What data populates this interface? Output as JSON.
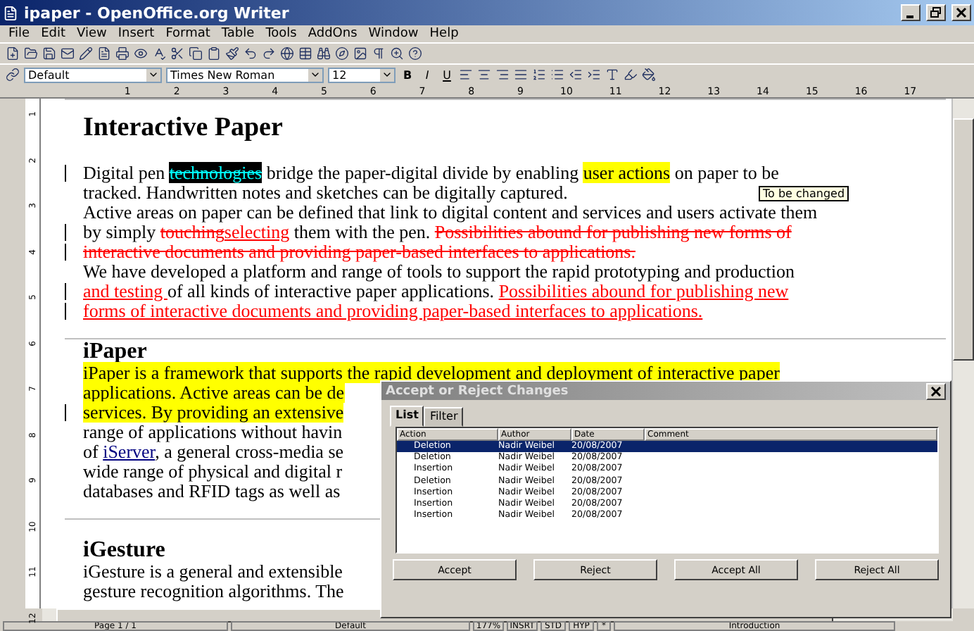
{
  "window": {
    "title": "ipaper - OpenOffice.org Writer"
  },
  "menu": [
    "File",
    "Edit",
    "View",
    "Insert",
    "Format",
    "Table",
    "Tools",
    "AddOns",
    "Window",
    "Help"
  ],
  "format_bar": {
    "style": "Default",
    "font": "Times New Roman",
    "size": "12",
    "bold": "B",
    "italic": "I",
    "underline": "U"
  },
  "ruler": {
    "horizontal": [
      "1",
      "2",
      "3",
      "4",
      "5",
      "6",
      "7",
      "8",
      "9",
      "10",
      "11",
      "12",
      "13",
      "14",
      "15",
      "16",
      "17"
    ],
    "vertical": [
      "1",
      "2",
      "3",
      "4",
      "5",
      "6",
      "7",
      "8",
      "9",
      "10",
      "11",
      "12"
    ]
  },
  "document": {
    "sections": [
      {
        "heading": "Interactive Paper",
        "kind": "title",
        "paragraphs": [
          [
            {
              "changed": true,
              "segments": [
                {
                  "kind": "normal",
                  "text": "Digital pen "
                },
                {
                  "kind": "selected_deletion",
                  "text": "technologies"
                },
                {
                  "kind": "normal",
                  "text": " bridge the paper-digital divide by enabling "
                },
                {
                  "kind": "highlight",
                  "text": "user actions"
                },
                {
                  "kind": "normal",
                  "text": " on paper to be"
                }
              ]
            },
            {
              "changed": false,
              "segments": [
                {
                  "kind": "normal",
                  "text": "tracked. Handwritten notes and sketches can be digitally captured."
                }
              ]
            }
          ],
          [
            {
              "changed": false,
              "segments": [
                {
                  "kind": "normal",
                  "text": "Active areas on paper can be defined that link to digital content and services and users activate them"
                }
              ]
            },
            {
              "changed": true,
              "segments": [
                {
                  "kind": "normal",
                  "text": "by simply "
                },
                {
                  "kind": "deletion",
                  "text": "touching"
                },
                {
                  "kind": "insertion",
                  "text": "selecting"
                },
                {
                  "kind": "normal",
                  "text": " them with the pen. "
                },
                {
                  "kind": "deletion",
                  "text": "Possibilities abound for publishing new forms of"
                }
              ]
            },
            {
              "changed": true,
              "segments": [
                {
                  "kind": "deletion",
                  "text": "interactive documents and providing paper-based interfaces to applications."
                }
              ]
            }
          ],
          [
            {
              "changed": false,
              "segments": [
                {
                  "kind": "normal",
                  "text": "We have developed a platform and range of tools to support the rapid prototyping and production"
                }
              ]
            },
            {
              "changed": true,
              "segments": [
                {
                  "kind": "insertion",
                  "text": "and testing "
                },
                {
                  "kind": "normal",
                  "text": "of all kinds of interactive paper applications. "
                },
                {
                  "kind": "insertion",
                  "text": "Possibilities abound for publishing new"
                }
              ]
            },
            {
              "changed": true,
              "segments": [
                {
                  "kind": "insertion",
                  "text": "forms of interactive documents and providing paper-based interfaces to applications."
                }
              ]
            }
          ]
        ]
      },
      {
        "heading": "iPaper",
        "kind": "section",
        "paragraphs": [
          [
            {
              "changed": false,
              "segments": [
                {
                  "kind": "highlight",
                  "text": "iPaper is a framework that supports the rapid development and deployment of interactive paper"
                }
              ]
            },
            {
              "changed": false,
              "segments": [
                {
                  "kind": "highlight",
                  "text": "applications. Active areas can be de"
                }
              ]
            },
            {
              "changed": true,
              "segments": [
                {
                  "kind": "highlight",
                  "text": "services. By providing an extensive"
                }
              ]
            },
            {
              "changed": false,
              "segments": [
                {
                  "kind": "normal",
                  "text": "range of applications without havin"
                }
              ]
            },
            {
              "changed": false,
              "segments": [
                {
                  "kind": "normal",
                  "text": "of "
                },
                {
                  "kind": "link",
                  "text": "iServer"
                },
                {
                  "kind": "normal",
                  "text": ", a general cross-media se"
                }
              ]
            },
            {
              "changed": false,
              "segments": [
                {
                  "kind": "normal",
                  "text": "wide range of physical and digital r"
                }
              ]
            },
            {
              "changed": false,
              "segments": [
                {
                  "kind": "normal",
                  "text": "databases and RFID tags as well as"
                }
              ]
            }
          ]
        ]
      },
      {
        "heading": "iGesture",
        "kind": "section",
        "paragraphs": [
          [
            {
              "changed": false,
              "segments": [
                {
                  "kind": "normal",
                  "text": "iGesture is a general and extensible"
                }
              ]
            },
            {
              "changed": false,
              "segments": [
                {
                  "kind": "normal",
                  "text": "gesture recognition algorithms. The"
                }
              ]
            }
          ]
        ]
      }
    ]
  },
  "tooltip": "To be changed",
  "dialog": {
    "title": "Accept or Reject Changes",
    "tabs": [
      {
        "label": "List",
        "selected": true
      },
      {
        "label": "Filter",
        "selected": false
      }
    ],
    "columns": [
      "Action",
      "Author",
      "Date",
      "Comment"
    ],
    "rows": [
      {
        "action": "Deletion",
        "author": "Nadir Weibel",
        "date": "20/08/2007",
        "selected": true
      },
      {
        "action": "Deletion",
        "author": "Nadir Weibel",
        "date": "20/08/2007",
        "selected": false
      },
      {
        "action": "Insertion",
        "author": "Nadir Weibel",
        "date": "20/08/2007",
        "selected": false
      },
      {
        "action": "Deletion",
        "author": "Nadir Weibel",
        "date": "20/08/2007",
        "selected": false
      },
      {
        "action": "Insertion",
        "author": "Nadir Weibel",
        "date": "20/08/2007",
        "selected": false
      },
      {
        "action": "Insertion",
        "author": "Nadir Weibel",
        "date": "20/08/2007",
        "selected": false
      },
      {
        "action": "Insertion",
        "author": "Nadir Weibel",
        "date": "20/08/2007",
        "selected": false
      }
    ],
    "buttons": [
      "Accept",
      "Reject",
      "Accept All",
      "Reject All"
    ]
  },
  "status_bar": [
    "Page 1 / 1",
    "Default",
    "177%",
    "INSRT",
    "STD",
    "HYP",
    "*",
    "Introduction"
  ]
}
